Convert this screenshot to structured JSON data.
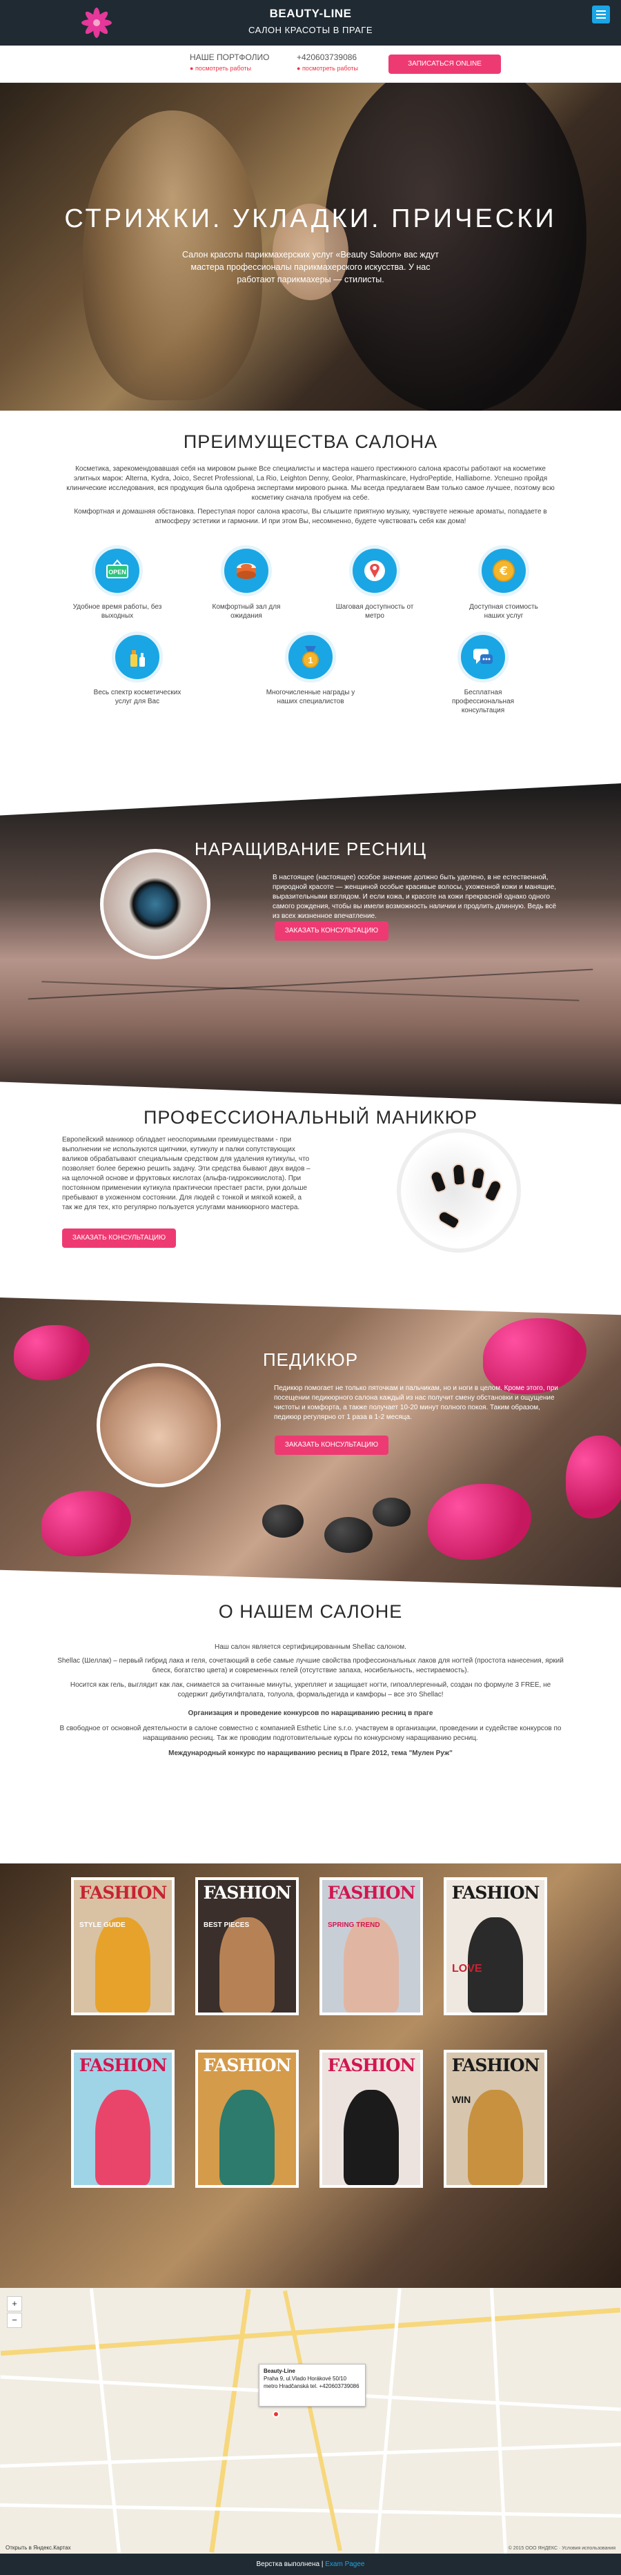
{
  "header": {
    "brand": "BEAUTY-LINE",
    "tagline": "САЛОН КРАСОТЫ В ПРАГЕ"
  },
  "infobar": {
    "portfolio_title": "НАШЕ ПОРТФОЛИО",
    "portfolio_link": "посмотреть работы",
    "phone": "+420603739086",
    "phone_link": "посмотреть работы",
    "signup_button": "ЗАПИСАТЬСЯ ONLINE"
  },
  "hero": {
    "title": "СТРИЖКИ. УКЛАДКИ. ПРИЧЕСКИ",
    "text": "Салон красоты парикмахерских услуг «Beauty Saloon» вас ждут мастера профессионалы парикмахерского искусства. У нас работают парикмахеры — стилисты."
  },
  "advantages": {
    "title": "ПРЕИМУЩЕСТВА САЛОНА",
    "para1": "Косметика, зарекомендовавшая себя на мировом рынке Все специалисты и мастера нашего престижного салона красоты работают на косметике элитных марок: Alterna, Kydra, Joico, Secret Professional, La Rio, Leighton Denny, Geolor, Pharmaskincare, HydroPeptide, Halliaborne. Успешно пройдя клинические исследования, вся продукция была одобрена экспертами мирового рынка. Мы всегда предлагаем Вам только самое лучшее, поэтому всю косметику сначала пробуем на себе.",
    "para2": "Комфортная и домашняя обстановка. Переступая порог салона красоты, Вы слышите приятную музыку, чувствуете нежные ароматы, попадаете в атмосферу эстетики и гармонии. И при этом Вы, несомненно, будете чувствовать себя как дома!",
    "items": [
      {
        "label": "Удобное время работы, без выходных",
        "icon": "open-sign-icon"
      },
      {
        "label": "Комфортный зал для ожидания",
        "icon": "cake-icon"
      },
      {
        "label": "Шаговая доступность от метро",
        "icon": "map-pin-icon"
      },
      {
        "label": "Доступная стоимость наших услуг",
        "icon": "euro-coin-icon"
      },
      {
        "label": "Весь спектр косметических услуг для Вас",
        "icon": "cosmetics-icon"
      },
      {
        "label": "Многочисленные награды у наших специалистов",
        "icon": "medal-icon"
      },
      {
        "label": "Бесплатная профессиональная консультация",
        "icon": "chat-icon"
      }
    ]
  },
  "lash": {
    "title": "НАРАЩИВАНИЕ РЕСНИЦ",
    "text": "В настоящее (настоящее) особое значение должно быть уделено, в не естественной, природной красоте — женщиной особые красивые волосы, ухоженной кожи и манящие, выразительными взглядом. И если кожа, и красоте на кожи прекрасной однако одного самого рождения, чтобы вы имели возможность наличии и продлить длинную. Ведь всё из всех жизненное впечатление.",
    "button": "ЗАКАЗАТЬ КОНСУЛЬТАЦИЮ"
  },
  "manicure": {
    "title": "ПРОФЕССИОНАЛЬНЫЙ МАНИКЮР",
    "text": "Европейский маникюр обладает неоспоримыми преимуществами - при выполнении не используются щипчики, кутикулу и палки сопутствующих валиков обрабатывают специальным средством для удаления кутикулы, что позволяет более бережно решить задачу. Эти средства бывают двух видов – на щелочной основе и фруктовых кислотах (альфа-гидроксикислота). При постоянном применении кутикула практически престает расти, руки дольше пребывают в ухоженном состоянии. Для людей с тонкой и мягкой кожей, а так же для тех, кто регулярно пользуется услугами маникюрного мастера.",
    "button": "ЗАКАЗАТЬ КОНСУЛЬТАЦИЮ"
  },
  "pedicure": {
    "title": "ПЕДИКЮР",
    "text": "Педикюр помогает не только пяточкам и пальчикам, но и ноги в целом. Кроме этого, при посещении педикюрного салона каждый из нас получит смену обстановки и ощущение чистоты и комфорта, а также получает 10-20 минут полного покоя. Таким образом, педикюр регулярно от 1 раза в 1-2 месяца.",
    "button": "ЗАКАЗАТЬ КОНСУЛЬТАЦИЮ"
  },
  "about": {
    "title": "О НАШЕМ САЛОНЕ",
    "p1": "Наш салон является сертифицированным Shellac салоном.",
    "p2": "Shellac (Шеллак) – первый гибрид лака и геля, сочетающий в себе самые лучшие свойства профессиональных лаков для ногтей (простота нанесения, яркий блеск, богатство цвета) и современных гелей (отсутствие запаха, носибельность, нестираемость).",
    "p3": "Носится как гель, выглядит как лак, снимается за считанные минуты, укрепляет и защищает ногти, гипоаллергенный, создан по формуле 3 FREE, не содержит дибутилфталата, толуола, формальдегида и камфоры – все это Shellac!",
    "p4": "Организация и проведение конкурсов по наращиванию ресниц в праге",
    "p5": "В свободное от основной деятельности в салоне совместно с компанией Esthetic Line s.r.o. участвуем в организации, проведении и судействе конкурсов по наращиванию ресниц. Так же проводим подготовительные курсы по конкурсному наращиванию ресниц.",
    "p6": "Международный конкурс по наращиванию ресниц в Праге 2012, тема \"Мулен Руж\""
  },
  "magazines": [
    {
      "title": "FASHION",
      "tag": "STYLE GUIDE",
      "bg": "#d8c2a3",
      "fig": "#e7a22b"
    },
    {
      "title": "FASHION",
      "tag": "BEST PIECES",
      "bg": "#3a2f2a",
      "fig": "#b68255"
    },
    {
      "title": "FASHION",
      "tag": "SPRING TREND",
      "bg": "#c8ced6",
      "fig": "#e0b6a2"
    },
    {
      "title": "FASHION",
      "tag": "LOVE",
      "bg": "#efe8e0",
      "fig": "#2a2a2a"
    },
    {
      "title": "FASHION",
      "tag": "",
      "bg": "#9fd3e6",
      "fig": "#e9456b"
    },
    {
      "title": "FASHION",
      "tag": "",
      "bg": "#d49b4b",
      "fig": "#2c7b6c"
    },
    {
      "title": "FASHION",
      "tag": "",
      "bg": "#ece3df",
      "fig": "#1b1b1b"
    },
    {
      "title": "FASHION",
      "tag": "WIN",
      "bg": "#d7c6ad",
      "fig": "#c7913f"
    }
  ],
  "map": {
    "balloon_title": "Beauty-Line",
    "balloon_text": "Praha 9, ul.Vlado Horákové 50/10 metro Hradčanská tel. +420603739086",
    "link": "Открыть в Яндекс.Картах",
    "copyright": "© 2015 ООО ЯНДЕКС · Условия использования",
    "zoom_in": "+",
    "zoom_out": "−"
  },
  "footer": {
    "text": "Верстка выполнена",
    "link": "Exam Pagee"
  },
  "colors": {
    "accent": "#ee3a73",
    "blue": "#1aa6e4",
    "dark": "#1f2a33"
  }
}
